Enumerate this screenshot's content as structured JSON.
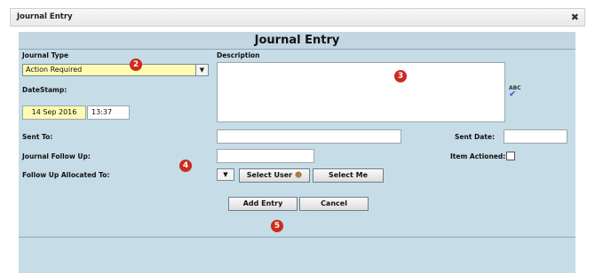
{
  "window": {
    "title": "Journal Entry",
    "close_glyph": "✖"
  },
  "form": {
    "heading": "Journal Entry",
    "journal_type": {
      "label": "Journal Type",
      "value": "Action Required"
    },
    "description": {
      "label": "Description",
      "value": ""
    },
    "datestamp": {
      "label": "DateStamp:",
      "date": "14 Sep 2016",
      "time": "13:37"
    },
    "sent_to": {
      "label": "Sent To:",
      "value": ""
    },
    "sent_date": {
      "label": "Sent Date:",
      "value": ""
    },
    "follow_up": {
      "label": "Journal Follow Up:",
      "value": ""
    },
    "item_actioned": {
      "label": "Item Actioned:",
      "checked": false
    },
    "allocated_to": {
      "label": "Follow Up Allocated To:",
      "value": ""
    },
    "spellcheck": {
      "text": "ABC",
      "icon": "spellcheck-icon"
    }
  },
  "buttons": {
    "select_user": "Select User",
    "select_me": "Select Me",
    "add_entry": "Add Entry",
    "cancel": "Cancel"
  },
  "markers": [
    "2",
    "3",
    "4",
    "5"
  ],
  "colors": {
    "panel": "#c6dce7",
    "highlight": "#fffbb4",
    "badge": "#cc2b1f"
  }
}
